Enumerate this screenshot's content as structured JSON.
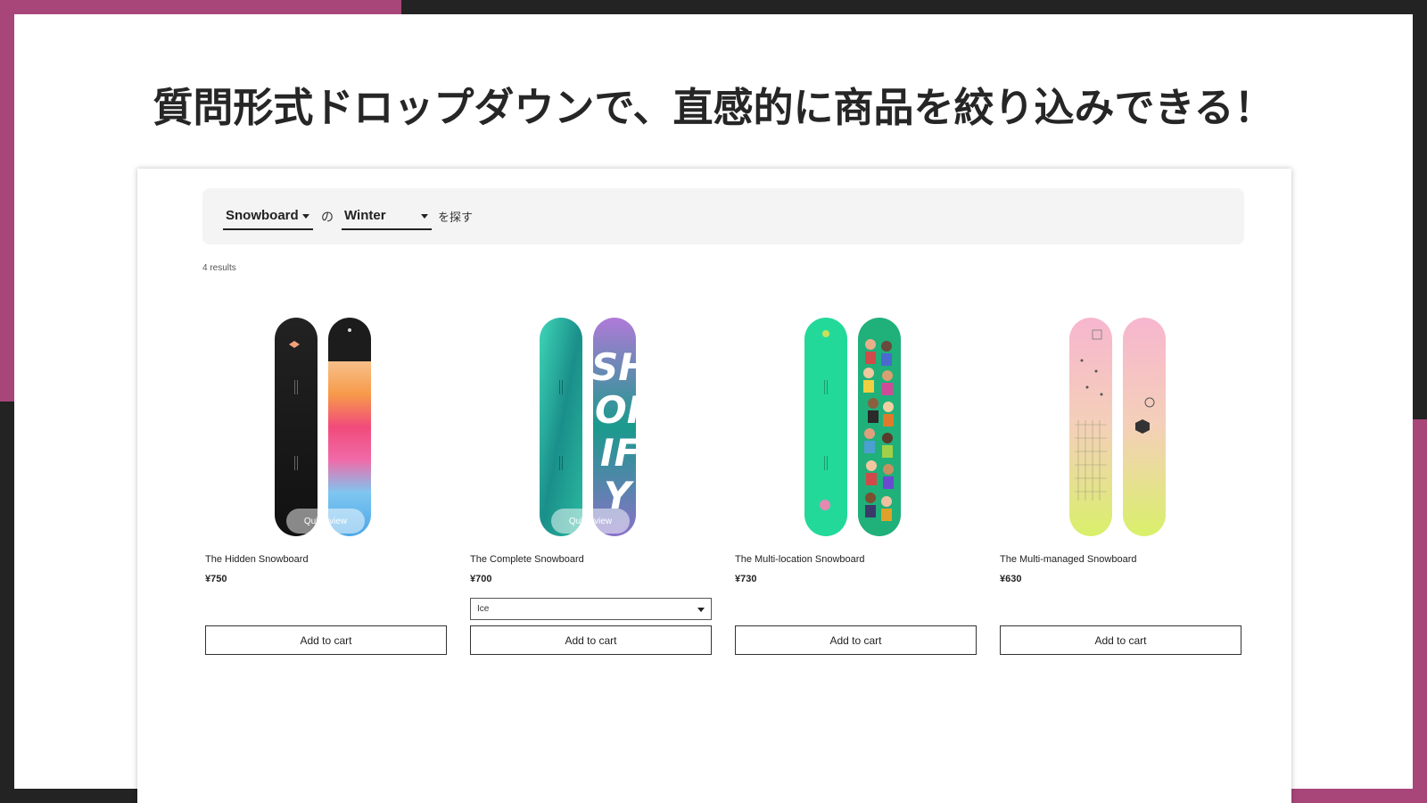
{
  "headline": "質問形式ドロップダウンで、直感的に商品を絞り込みできる！",
  "filter": {
    "category": "Snowboard",
    "connector": "の",
    "season": "Winter",
    "suffix": "を探す"
  },
  "results_text": "4 results",
  "quick_view_label": "Quick view",
  "add_to_cart_label": "Add to cart",
  "products": [
    {
      "title": "The Hidden Snowboard",
      "price": "¥750"
    },
    {
      "title": "The Complete Snowboard",
      "price": "¥700",
      "variant": "Ice"
    },
    {
      "title": "The Multi-location Snowboard",
      "price": "¥730"
    },
    {
      "title": "The Multi-managed Snowboard",
      "price": "¥630"
    }
  ],
  "colors": {
    "accent_pink": "#a8467a",
    "frame_dark": "#232323"
  }
}
